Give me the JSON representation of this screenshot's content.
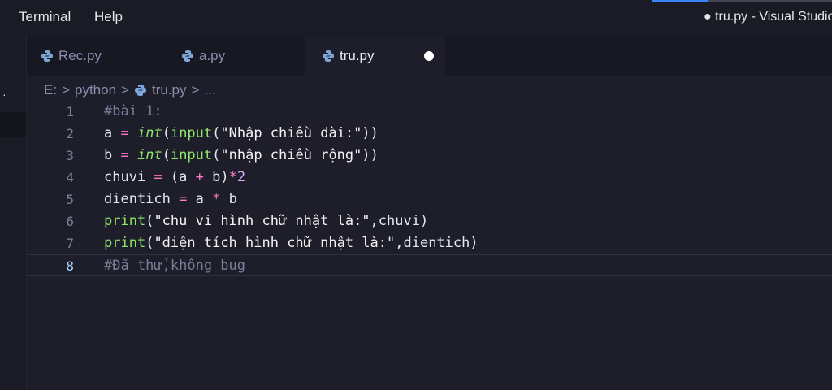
{
  "menu": {
    "terminal": "Terminal",
    "help": "Help"
  },
  "window": {
    "title": "● tru.py - Visual Studio Code"
  },
  "activity": {
    "dot_glyph": "·"
  },
  "tabs": [
    {
      "label": "Rec.py",
      "icon": "python-file-icon",
      "active": false
    },
    {
      "label": "a.py",
      "icon": "python-file-icon",
      "active": false
    },
    {
      "label": "tru.py",
      "icon": "python-file-icon",
      "active": true,
      "dirty": true
    }
  ],
  "breadcrumb": {
    "drive": "E:",
    "folder": "python",
    "file": "tru.py",
    "more": "...",
    "separator": ">"
  },
  "editor": {
    "current_line": 8,
    "lines": [
      {
        "n": "1",
        "tokens": [
          {
            "t": "comment",
            "v": "#bài 1:"
          }
        ]
      },
      {
        "n": "2",
        "tokens": [
          {
            "t": "plain",
            "v": "a "
          },
          {
            "t": "op",
            "v": "="
          },
          {
            "t": "plain",
            "v": " "
          },
          {
            "t": "kw",
            "v": "int"
          },
          {
            "t": "plain",
            "v": "("
          },
          {
            "t": "fn",
            "v": "input"
          },
          {
            "t": "plain",
            "v": "("
          },
          {
            "t": "str",
            "v": "\"Nhập chiều dài:\""
          },
          {
            "t": "plain",
            "v": "))"
          }
        ]
      },
      {
        "n": "3",
        "tokens": [
          {
            "t": "plain",
            "v": "b "
          },
          {
            "t": "op",
            "v": "="
          },
          {
            "t": "plain",
            "v": " "
          },
          {
            "t": "kw",
            "v": "int"
          },
          {
            "t": "plain",
            "v": "("
          },
          {
            "t": "fn",
            "v": "input"
          },
          {
            "t": "plain",
            "v": "("
          },
          {
            "t": "str",
            "v": "\"nhập chiều rộng\""
          },
          {
            "t": "plain",
            "v": "))"
          }
        ]
      },
      {
        "n": "4",
        "tokens": [
          {
            "t": "plain",
            "v": "chuvi "
          },
          {
            "t": "op",
            "v": "="
          },
          {
            "t": "plain",
            "v": " (a "
          },
          {
            "t": "op",
            "v": "+"
          },
          {
            "t": "plain",
            "v": " b)"
          },
          {
            "t": "op",
            "v": "*"
          },
          {
            "t": "num",
            "v": "2"
          }
        ]
      },
      {
        "n": "5",
        "tokens": [
          {
            "t": "plain",
            "v": "dientich "
          },
          {
            "t": "op",
            "v": "="
          },
          {
            "t": "plain",
            "v": " a "
          },
          {
            "t": "op",
            "v": "*"
          },
          {
            "t": "plain",
            "v": " b"
          }
        ]
      },
      {
        "n": "6",
        "tokens": [
          {
            "t": "fn",
            "v": "print"
          },
          {
            "t": "plain",
            "v": "("
          },
          {
            "t": "str",
            "v": "\"chu vi hình chữ nhật là:\""
          },
          {
            "t": "plain",
            "v": ",chuvi)"
          }
        ]
      },
      {
        "n": "7",
        "tokens": [
          {
            "t": "fn",
            "v": "print"
          },
          {
            "t": "plain",
            "v": "("
          },
          {
            "t": "str",
            "v": "\"diện tích hình chữ nhật là:\""
          },
          {
            "t": "plain",
            "v": ",dientich)"
          }
        ]
      },
      {
        "n": "8",
        "tokens": [
          {
            "t": "comment",
            "v": "#Đã thử,không bug"
          }
        ]
      }
    ]
  }
}
